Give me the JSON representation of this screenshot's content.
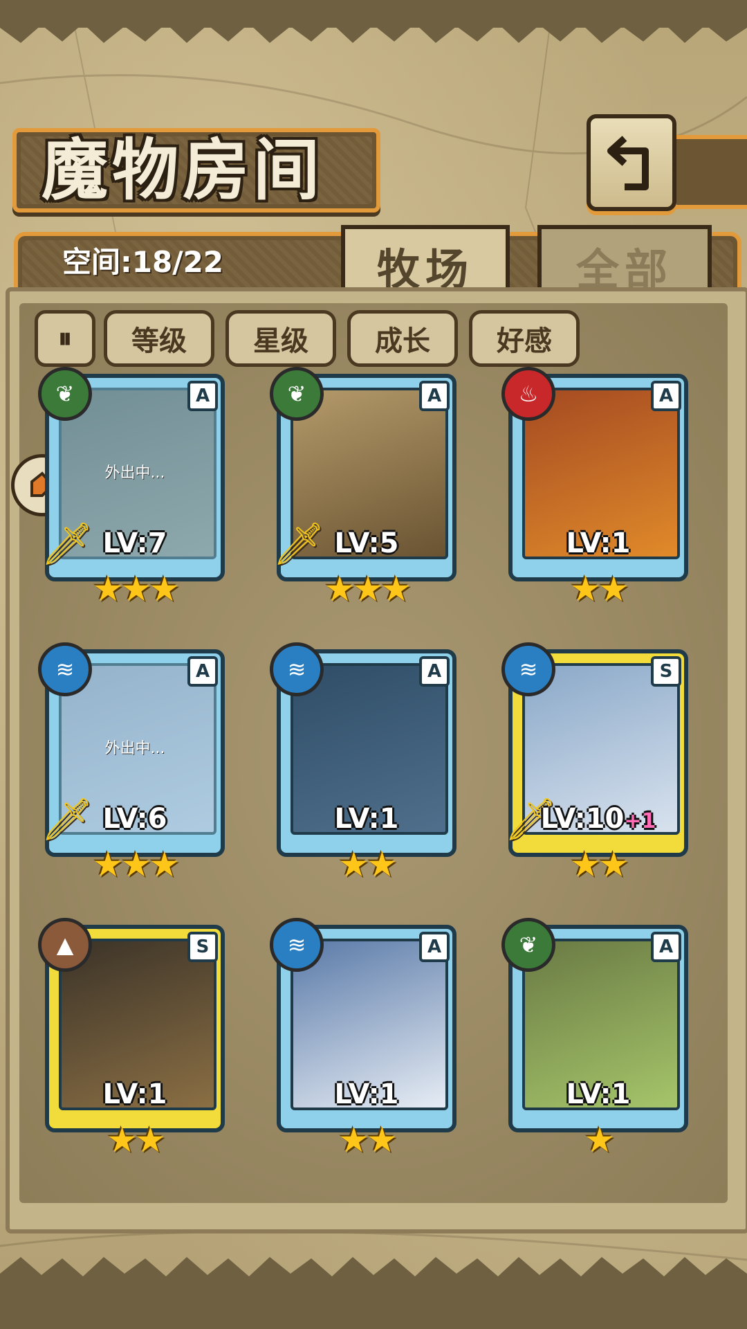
{
  "page": {
    "title": "魔物房间",
    "capacity": "空间:18/22"
  },
  "tabs": [
    {
      "label": "牧场",
      "active": true
    },
    {
      "label": "全部",
      "active": false
    }
  ],
  "sort_buttons": [
    {
      "label": "等级"
    },
    {
      "label": "星级"
    },
    {
      "label": "成长"
    },
    {
      "label": "好感"
    }
  ],
  "colors": {
    "accent": "#e39a3a",
    "frame_A": "#8fd0ea",
    "frame_S": "#f2dc3b",
    "star": "#ffc61a"
  },
  "monsters": [
    {
      "element": "grass-icon",
      "grade": "A",
      "level": "LV:7",
      "stars": "★★★",
      "status": "外出中...",
      "weapon": true
    },
    {
      "element": "grass-icon",
      "grade": "A",
      "level": "LV:5",
      "stars": "★★★",
      "status": "",
      "weapon": true
    },
    {
      "element": "fire-icon",
      "grade": "A",
      "level": "LV:1",
      "stars": "★★",
      "status": "",
      "weapon": false
    },
    {
      "element": "water-icon",
      "grade": "A",
      "level": "LV:6",
      "stars": "★★★",
      "status": "外出中...",
      "weapon": true
    },
    {
      "element": "water-icon",
      "grade": "A",
      "level": "LV:1",
      "stars": "★★",
      "status": "",
      "weapon": false
    },
    {
      "element": "water-icon",
      "grade": "S",
      "level": "LV:10",
      "level_bonus": "+1",
      "stars": "★★",
      "status": "",
      "weapon": true
    },
    {
      "element": "earth-icon",
      "grade": "S",
      "level": "LV:1",
      "stars": "★★",
      "status": "",
      "weapon": false
    },
    {
      "element": "water-icon",
      "grade": "A",
      "level": "LV:1",
      "stars": "★★",
      "status": "",
      "weapon": false
    },
    {
      "element": "grass-icon",
      "grade": "A",
      "level": "LV:1",
      "stars": "★",
      "status": "",
      "weapon": false
    }
  ]
}
